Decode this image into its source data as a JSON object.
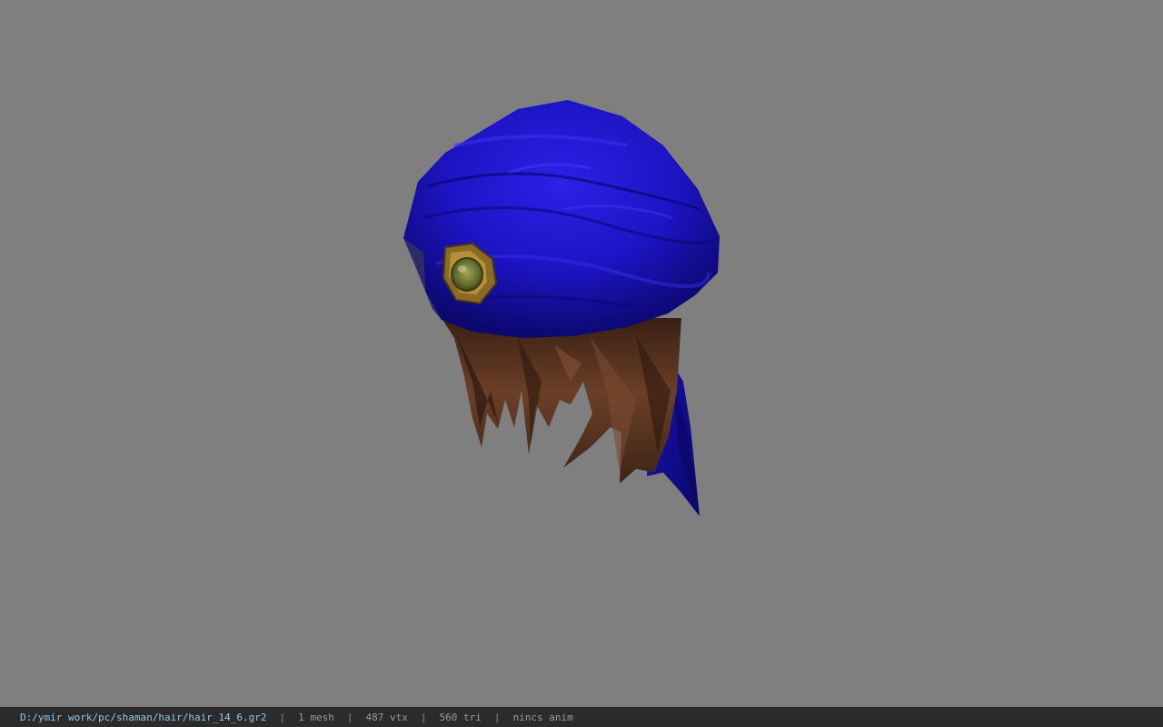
{
  "viewport": {
    "background": "#7f7f7f",
    "model": {
      "bandana_color": "#1b12c8",
      "hair_color": "#5a3420",
      "emblem_color": "#9a7a2c"
    }
  },
  "status_bar": {
    "path": "D:/ymir work/pc/shaman/hair/hair_14_6.gr2",
    "separator": "|",
    "mesh": "1 mesh",
    "vertices": "487 vtx",
    "triangles": "560 tri",
    "anim": "nincs anim"
  }
}
